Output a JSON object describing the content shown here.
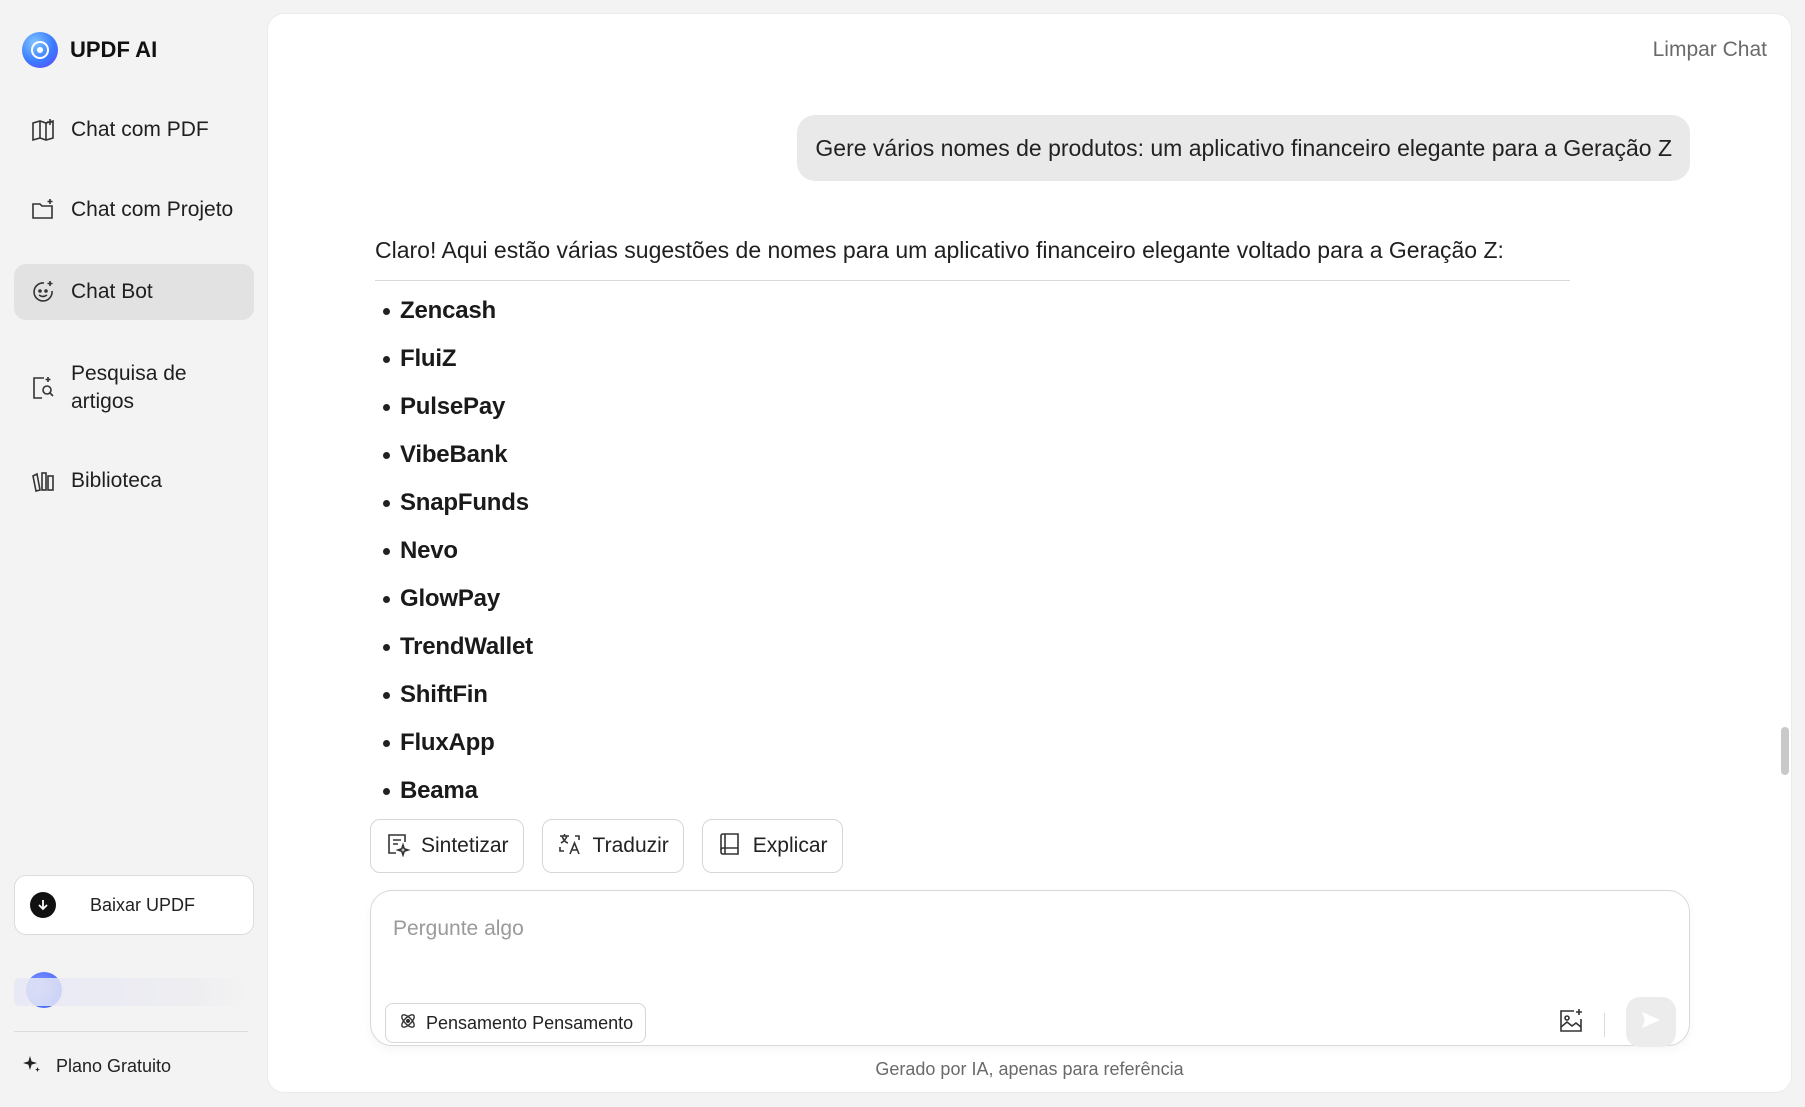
{
  "brand": {
    "name": "UPDF AI"
  },
  "sidebar": {
    "items": [
      {
        "label": "Chat com PDF",
        "icon": "book-open-icon"
      },
      {
        "label": "Chat com Projeto",
        "icon": "folder-add-icon"
      },
      {
        "label": "Chat Bot",
        "icon": "bot-face-icon",
        "active": true
      },
      {
        "label": "Pesquisa de artigos",
        "icon": "doc-search-icon"
      },
      {
        "label": "Biblioteca",
        "icon": "library-icon"
      }
    ],
    "download_label": "Baixar UPDF",
    "plan_label": "Plano Gratuito"
  },
  "header": {
    "clear_chat": "Limpar Chat"
  },
  "chat": {
    "user_message": "Gere vários nomes de produtos: um aplicativo financeiro elegante para a Geração Z",
    "reply_intro": "Claro! Aqui estão várias sugestões de nomes para um aplicativo financeiro elegante voltado para a Geração Z:",
    "reply_items": [
      "Zencash",
      "FluiZ",
      "PulsePay",
      "VibeBank",
      "SnapFunds",
      "Nevo",
      "GlowPay",
      "TrendWallet",
      "ShiftFin",
      "FluxApp",
      "Beama"
    ]
  },
  "actions": [
    {
      "label": "Sintetizar",
      "icon": "summarize-icon"
    },
    {
      "label": "Traduzir",
      "icon": "translate-icon"
    },
    {
      "label": "Explicar",
      "icon": "book-icon"
    }
  ],
  "composer": {
    "placeholder": "Pergunte algo",
    "value": "",
    "think_label": "Pensamento Pensamento"
  },
  "footer": {
    "disclaimer": "Gerado por IA, apenas para referência"
  },
  "colors": {
    "active_nav": "#e2e2e2",
    "send_disabled": "#ececec",
    "accent": "#3a7bff"
  }
}
